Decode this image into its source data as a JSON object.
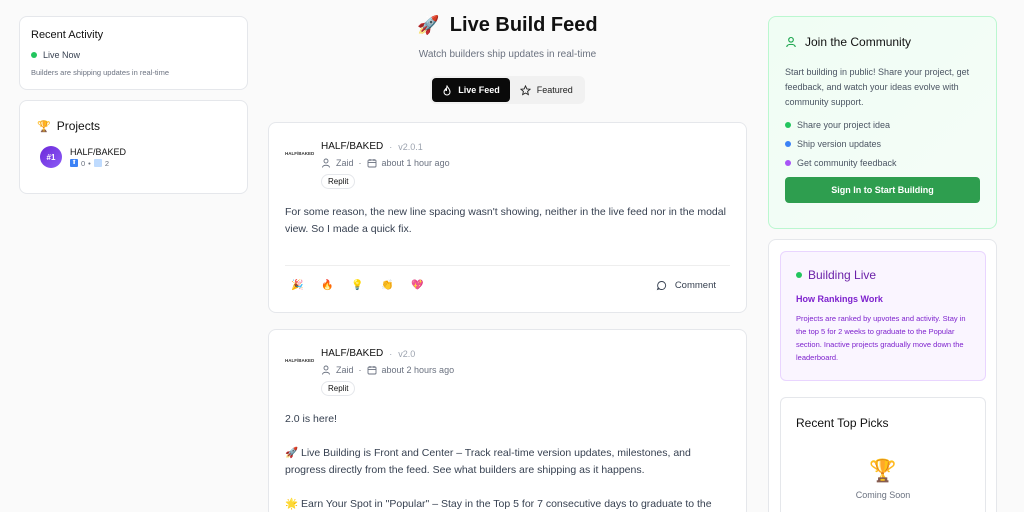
{
  "recent_activity": {
    "title": "Recent Activity",
    "status": "Live Now",
    "subtitle": "Builders are shipping updates in real-time",
    "status_color": "#22c55e"
  },
  "projects": {
    "title": "Projects",
    "icon": "trophy-icon",
    "items": [
      {
        "rank": "#1",
        "name": "HALF/BAKED",
        "upvotes": "0",
        "updates": "2"
      }
    ]
  },
  "header": {
    "title": "Live Build Feed",
    "icon": "rocket-icon",
    "tagline": "Watch builders ship updates in real-time",
    "tabs": [
      {
        "label": "Live Feed",
        "icon": "flame-icon",
        "active": true
      },
      {
        "label": "Featured",
        "icon": "star-icon",
        "active": false
      }
    ]
  },
  "posts": [
    {
      "logo_text": "HALF/BAKED",
      "project": "HALF/BAKED",
      "version": "v2.0.1",
      "author": "Zaid",
      "time": "about 1 hour ago",
      "platform": "Replit",
      "body": [
        "For some reason, the new line spacing wasn't showing, neither in the live feed nor in the modal view. So I made a quick fix."
      ],
      "reactions": [
        "🎉",
        "🔥",
        "💡",
        "👏",
        "💖"
      ],
      "comment_label": "Comment"
    },
    {
      "logo_text": "HALF/BAKED",
      "project": "HALF/BAKED",
      "version": "v2.0",
      "author": "Zaid",
      "time": "about 2 hours ago",
      "platform": "Replit",
      "body": [
        "2.0 is here!",
        "🚀 Live Building is Front and Center – Track real-time version updates, milestones, and progress directly from the feed. See what builders are shipping as it happens.",
        "🌟 Earn Your Spot in \"Popular\" – Stay in the Top 5 for 7 consecutive days to graduate to the"
      ]
    }
  ],
  "join": {
    "title": "Join the Community",
    "icon": "user-icon",
    "description": "Start building in public! Share your project, get feedback, and watch your ideas evolve with community support.",
    "items": [
      {
        "label": "Share your project idea",
        "color": "#22c55e"
      },
      {
        "label": "Ship version updates",
        "color": "#3b82f6"
      },
      {
        "label": "Get community feedback",
        "color": "#a855f7"
      }
    ],
    "button_label": "Sign In to Start Building",
    "button_color": "#2e9e4f"
  },
  "building_live": {
    "title": "Building Live",
    "subtitle": "How Rankings Work",
    "text": "Projects are ranked by upvotes and activity. Stay in the top 5 for 2 weeks to graduate to the Popular section. Inactive projects gradually move down the leaderboard.",
    "dot_color": "#22c55e"
  },
  "top_picks": {
    "title": "Recent Top Picks",
    "icon": "trophy-icon",
    "empty_text": "Coming Soon"
  }
}
